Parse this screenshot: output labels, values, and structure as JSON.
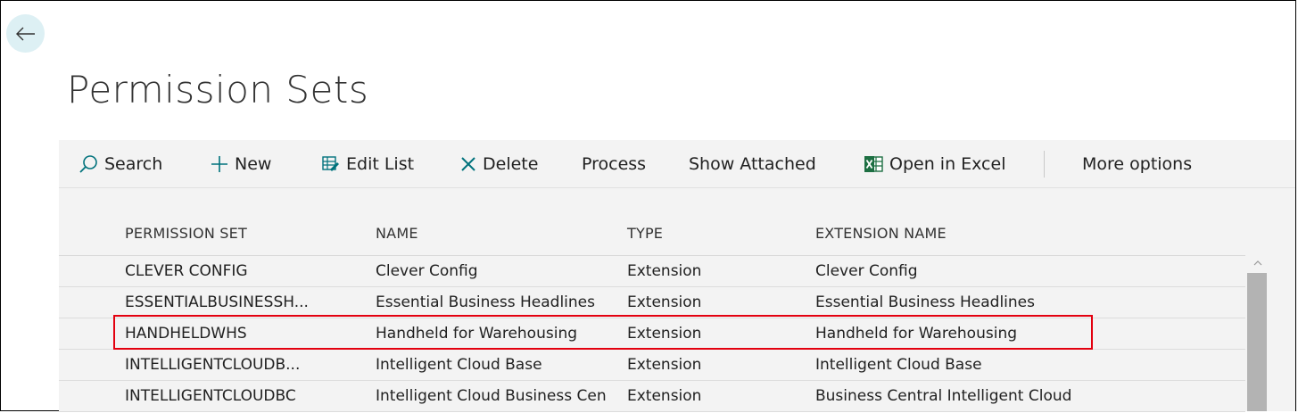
{
  "page": {
    "title": "Permission Sets"
  },
  "toolbar": {
    "search": "Search",
    "new": "New",
    "edit_list": "Edit List",
    "delete": "Delete",
    "process": "Process",
    "show_attached": "Show Attached",
    "open_in_excel": "Open in Excel",
    "more_options": "More options"
  },
  "table": {
    "columns": [
      "PERMISSION SET",
      "NAME",
      "TYPE",
      "EXTENSION NAME"
    ],
    "rows": [
      {
        "permission_set": "CLEVER CONFIG",
        "name": "Clever Config",
        "type": "Extension",
        "extension_name": "Clever Config"
      },
      {
        "permission_set": "ESSENTIALBUSINESSH...",
        "name": "Essential Business Headlines",
        "type": "Extension",
        "extension_name": "Essential Business Headlines"
      },
      {
        "permission_set": "HANDHELDWHS",
        "name": "Handheld for Warehousing",
        "type": "Extension",
        "extension_name": "Handheld for Warehousing"
      },
      {
        "permission_set": "INTELLIGENTCLOUDB...",
        "name": "Intelligent Cloud Base",
        "type": "Extension",
        "extension_name": "Intelligent Cloud Base"
      },
      {
        "permission_set": "INTELLIGENTCLOUDBC",
        "name": "Intelligent Cloud Business Cen",
        "type": "Extension",
        "extension_name": "Business Central Intelligent Cloud"
      }
    ]
  },
  "colors": {
    "accent": "#00727c",
    "excel": "#1d6f42",
    "highlight": "#e3000f",
    "toolbar_bg": "#f3f3f3"
  },
  "icons": [
    "back-arrow-icon",
    "search-icon",
    "plus-icon",
    "edit-list-icon",
    "delete-x-icon",
    "excel-icon",
    "scroll-up-icon"
  ]
}
